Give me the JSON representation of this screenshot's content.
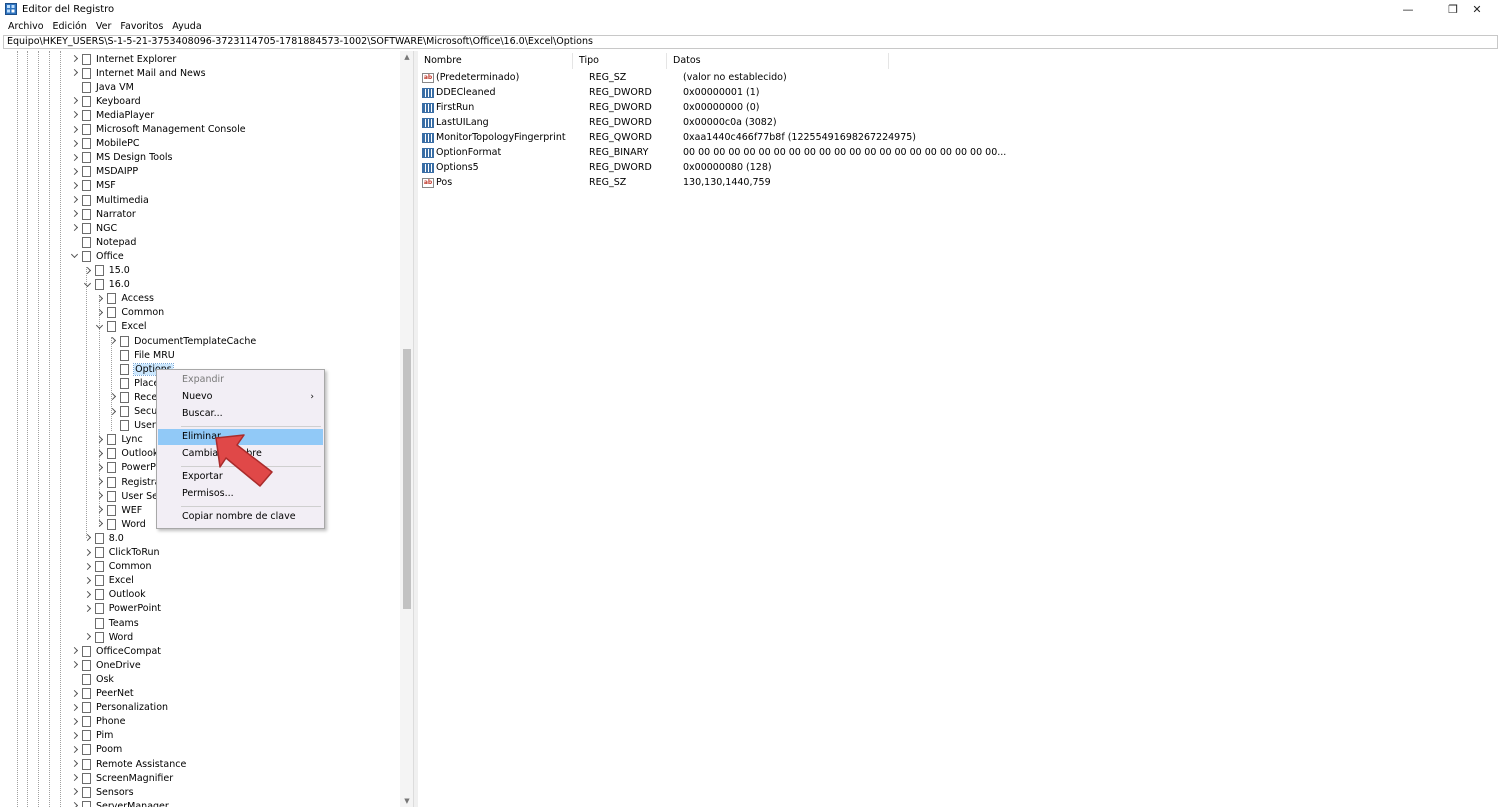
{
  "window": {
    "title": "Editor del Registro",
    "minimize_icon": "minimize-icon",
    "maximize_icon": "restore-icon",
    "close_icon": "close-icon",
    "min_glyph": "—",
    "max_glyph": "❐",
    "close_glyph": "✕"
  },
  "menu": [
    "Archivo",
    "Edición",
    "Ver",
    "Favoritos",
    "Ayuda"
  ],
  "address": "Equipo\\HKEY_USERS\\S-1-5-21-3753408096-3723114705-1781884573-1002\\SOFTWARE\\Microsoft\\Office\\16.0\\Excel\\Options",
  "tree": [
    {
      "label": "Internet Explorer",
      "level": 0,
      "chevron": "right"
    },
    {
      "label": "Internet Mail and News",
      "level": 0,
      "chevron": "right"
    },
    {
      "label": "Java VM",
      "level": 0,
      "chevron": "none"
    },
    {
      "label": "Keyboard",
      "level": 0,
      "chevron": "right"
    },
    {
      "label": "MediaPlayer",
      "level": 0,
      "chevron": "right"
    },
    {
      "label": "Microsoft Management Console",
      "level": 0,
      "chevron": "right"
    },
    {
      "label": "MobilePC",
      "level": 0,
      "chevron": "right"
    },
    {
      "label": "MS Design Tools",
      "level": 0,
      "chevron": "right"
    },
    {
      "label": "MSDAIPP",
      "level": 0,
      "chevron": "right"
    },
    {
      "label": "MSF",
      "level": 0,
      "chevron": "right"
    },
    {
      "label": "Multimedia",
      "level": 0,
      "chevron": "right"
    },
    {
      "label": "Narrator",
      "level": 0,
      "chevron": "right"
    },
    {
      "label": "NGC",
      "level": 0,
      "chevron": "right"
    },
    {
      "label": "Notepad",
      "level": 0,
      "chevron": "none"
    },
    {
      "label": "Office",
      "level": 0,
      "chevron": "down"
    },
    {
      "label": "15.0",
      "level": 1,
      "chevron": "right"
    },
    {
      "label": "16.0",
      "level": 1,
      "chevron": "down"
    },
    {
      "label": "Access",
      "level": 2,
      "chevron": "right"
    },
    {
      "label": "Common",
      "level": 2,
      "chevron": "right"
    },
    {
      "label": "Excel",
      "level": 2,
      "chevron": "down"
    },
    {
      "label": "DocumentTemplateCache",
      "level": 3,
      "chevron": "right"
    },
    {
      "label": "File MRU",
      "level": 3,
      "chevron": "none"
    },
    {
      "label": "Options",
      "level": 3,
      "chevron": "none",
      "selected": true
    },
    {
      "label": "Place",
      "level": 3,
      "chevron": "none"
    },
    {
      "label": "Rece",
      "level": 3,
      "chevron": "right"
    },
    {
      "label": "Secu",
      "level": 3,
      "chevron": "right"
    },
    {
      "label": "User",
      "level": 3,
      "chevron": "none"
    },
    {
      "label": "Lync",
      "level": 2,
      "chevron": "right"
    },
    {
      "label": "Outlook",
      "level": 2,
      "chevron": "right"
    },
    {
      "label": "PowerP",
      "level": 2,
      "chevron": "right"
    },
    {
      "label": "Registra",
      "level": 2,
      "chevron": "right"
    },
    {
      "label": "User Set",
      "level": 2,
      "chevron": "right"
    },
    {
      "label": "WEF",
      "level": 2,
      "chevron": "right"
    },
    {
      "label": "Word",
      "level": 2,
      "chevron": "right"
    },
    {
      "label": "8.0",
      "level": 1,
      "chevron": "right"
    },
    {
      "label": "ClickToRun",
      "level": 1,
      "chevron": "right"
    },
    {
      "label": "Common",
      "level": 1,
      "chevron": "right"
    },
    {
      "label": "Excel",
      "level": 1,
      "chevron": "right"
    },
    {
      "label": "Outlook",
      "level": 1,
      "chevron": "right"
    },
    {
      "label": "PowerPoint",
      "level": 1,
      "chevron": "right"
    },
    {
      "label": "Teams",
      "level": 1,
      "chevron": "none"
    },
    {
      "label": "Word",
      "level": 1,
      "chevron": "right"
    },
    {
      "label": "OfficeCompat",
      "level": 0,
      "chevron": "right"
    },
    {
      "label": "OneDrive",
      "level": 0,
      "chevron": "right"
    },
    {
      "label": "Osk",
      "level": 0,
      "chevron": "none"
    },
    {
      "label": "PeerNet",
      "level": 0,
      "chevron": "right"
    },
    {
      "label": "Personalization",
      "level": 0,
      "chevron": "right"
    },
    {
      "label": "Phone",
      "level": 0,
      "chevron": "right"
    },
    {
      "label": "Pim",
      "level": 0,
      "chevron": "right"
    },
    {
      "label": "Poom",
      "level": 0,
      "chevron": "right"
    },
    {
      "label": "Remote Assistance",
      "level": 0,
      "chevron": "right"
    },
    {
      "label": "ScreenMagnifier",
      "level": 0,
      "chevron": "right"
    },
    {
      "label": "Sensors",
      "level": 0,
      "chevron": "right"
    },
    {
      "label": "ServerManager",
      "level": 0,
      "chevron": "right"
    }
  ],
  "list": {
    "headers": [
      "Nombre",
      "Tipo",
      "Datos"
    ],
    "rows": [
      {
        "icon": "ab",
        "name": "(Predeterminado)",
        "type": "REG_SZ",
        "data": "(valor no establecido)"
      },
      {
        "icon": "bin",
        "name": "DDECleaned",
        "type": "REG_DWORD",
        "data": "0x00000001 (1)"
      },
      {
        "icon": "bin",
        "name": "FirstRun",
        "type": "REG_DWORD",
        "data": "0x00000000 (0)"
      },
      {
        "icon": "bin",
        "name": "LastUILang",
        "type": "REG_DWORD",
        "data": "0x00000c0a (3082)"
      },
      {
        "icon": "bin",
        "name": "MonitorTopologyFingerprint",
        "type": "REG_QWORD",
        "data": "0xaa1440c466f77b8f (12255491698267224975)"
      },
      {
        "icon": "bin",
        "name": "OptionFormat",
        "type": "REG_BINARY",
        "data": "00 00 00 00 00 00 00 00 00 00 00 00 00 00 00 00 00 00 00 00 00..."
      },
      {
        "icon": "bin",
        "name": "Options5",
        "type": "REG_DWORD",
        "data": "0x00000080 (128)"
      },
      {
        "icon": "ab",
        "name": "Pos",
        "type": "REG_SZ",
        "data": "130,130,1440,759"
      }
    ]
  },
  "context_menu": {
    "items": [
      {
        "label": "Expandir",
        "disabled": true
      },
      {
        "label": "Nuevo",
        "submenu": true
      },
      {
        "label": "Buscar..."
      },
      {
        "separator": true
      },
      {
        "label": "Eliminar",
        "hover": true
      },
      {
        "label": "Cambiar nombre"
      },
      {
        "separator": true
      },
      {
        "label": "Exportar"
      },
      {
        "label": "Permisos..."
      },
      {
        "separator": true
      },
      {
        "label": "Copiar nombre de clave"
      }
    ],
    "submenu_glyph": "›"
  },
  "colors": {
    "selection": "#cce8ff",
    "menu_hover": "#91c9f7",
    "pointer": "#e04848"
  }
}
